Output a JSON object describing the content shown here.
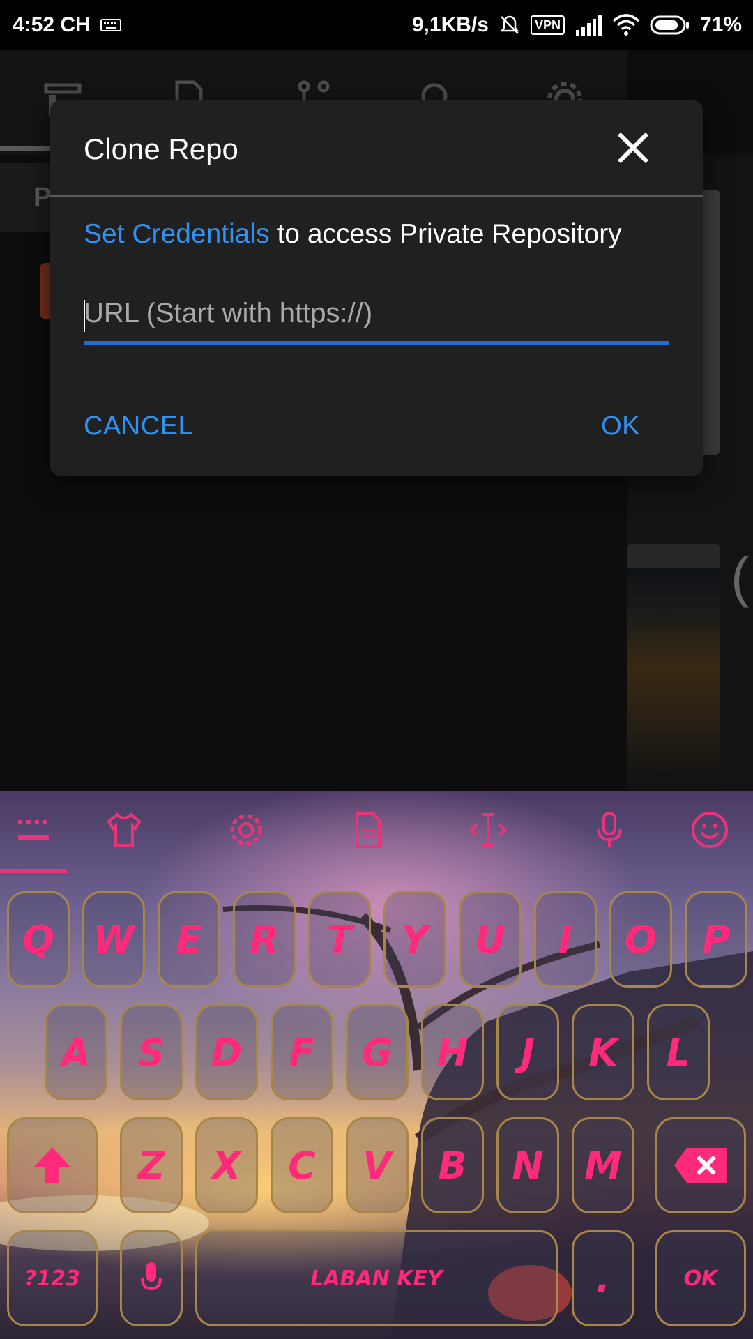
{
  "status_bar": {
    "time": "4:52 CH",
    "network_speed": "9,1KB/s",
    "vpn": "VPN",
    "battery": "71%",
    "icons": [
      "keyboard-icon",
      "mute-bell-icon",
      "vpn-icon",
      "signal-icon",
      "wifi-icon",
      "battery-icon"
    ]
  },
  "background_app": {
    "tab_label": "P",
    "toolbar_icons": [
      "repo-icon",
      "file-icon",
      "branch-icon",
      "search-icon",
      "settings-icon"
    ]
  },
  "dialog": {
    "title": "Clone Repo",
    "link_text": "Set Credentials",
    "message_rest": " to access Private Repository",
    "url_placeholder": "URL (Start with https://)",
    "url_value": "",
    "cancel_label": "CANCEL",
    "ok_label": "OK",
    "accent_color": "#2f93f5"
  },
  "keyboard": {
    "toolbar_icons": [
      "keyboard-icon",
      "theme-shirt-icon",
      "settings-icon",
      "clipboard-icon",
      "cursor-icon",
      "mic-icon",
      "emoji-icon"
    ],
    "row1": [
      "Q",
      "W",
      "E",
      "R",
      "T",
      "Y",
      "U",
      "I",
      "O",
      "P"
    ],
    "row2": [
      "A",
      "S",
      "D",
      "F",
      "G",
      "H",
      "J",
      "K",
      "L"
    ],
    "row3": [
      "Z",
      "X",
      "C",
      "V",
      "B",
      "N",
      "M"
    ],
    "symbols_label": "?123",
    "space_label": "LABAN KEY",
    "period_label": ".",
    "enter_label": "OK",
    "key_text_color": "#ff2a7a"
  }
}
